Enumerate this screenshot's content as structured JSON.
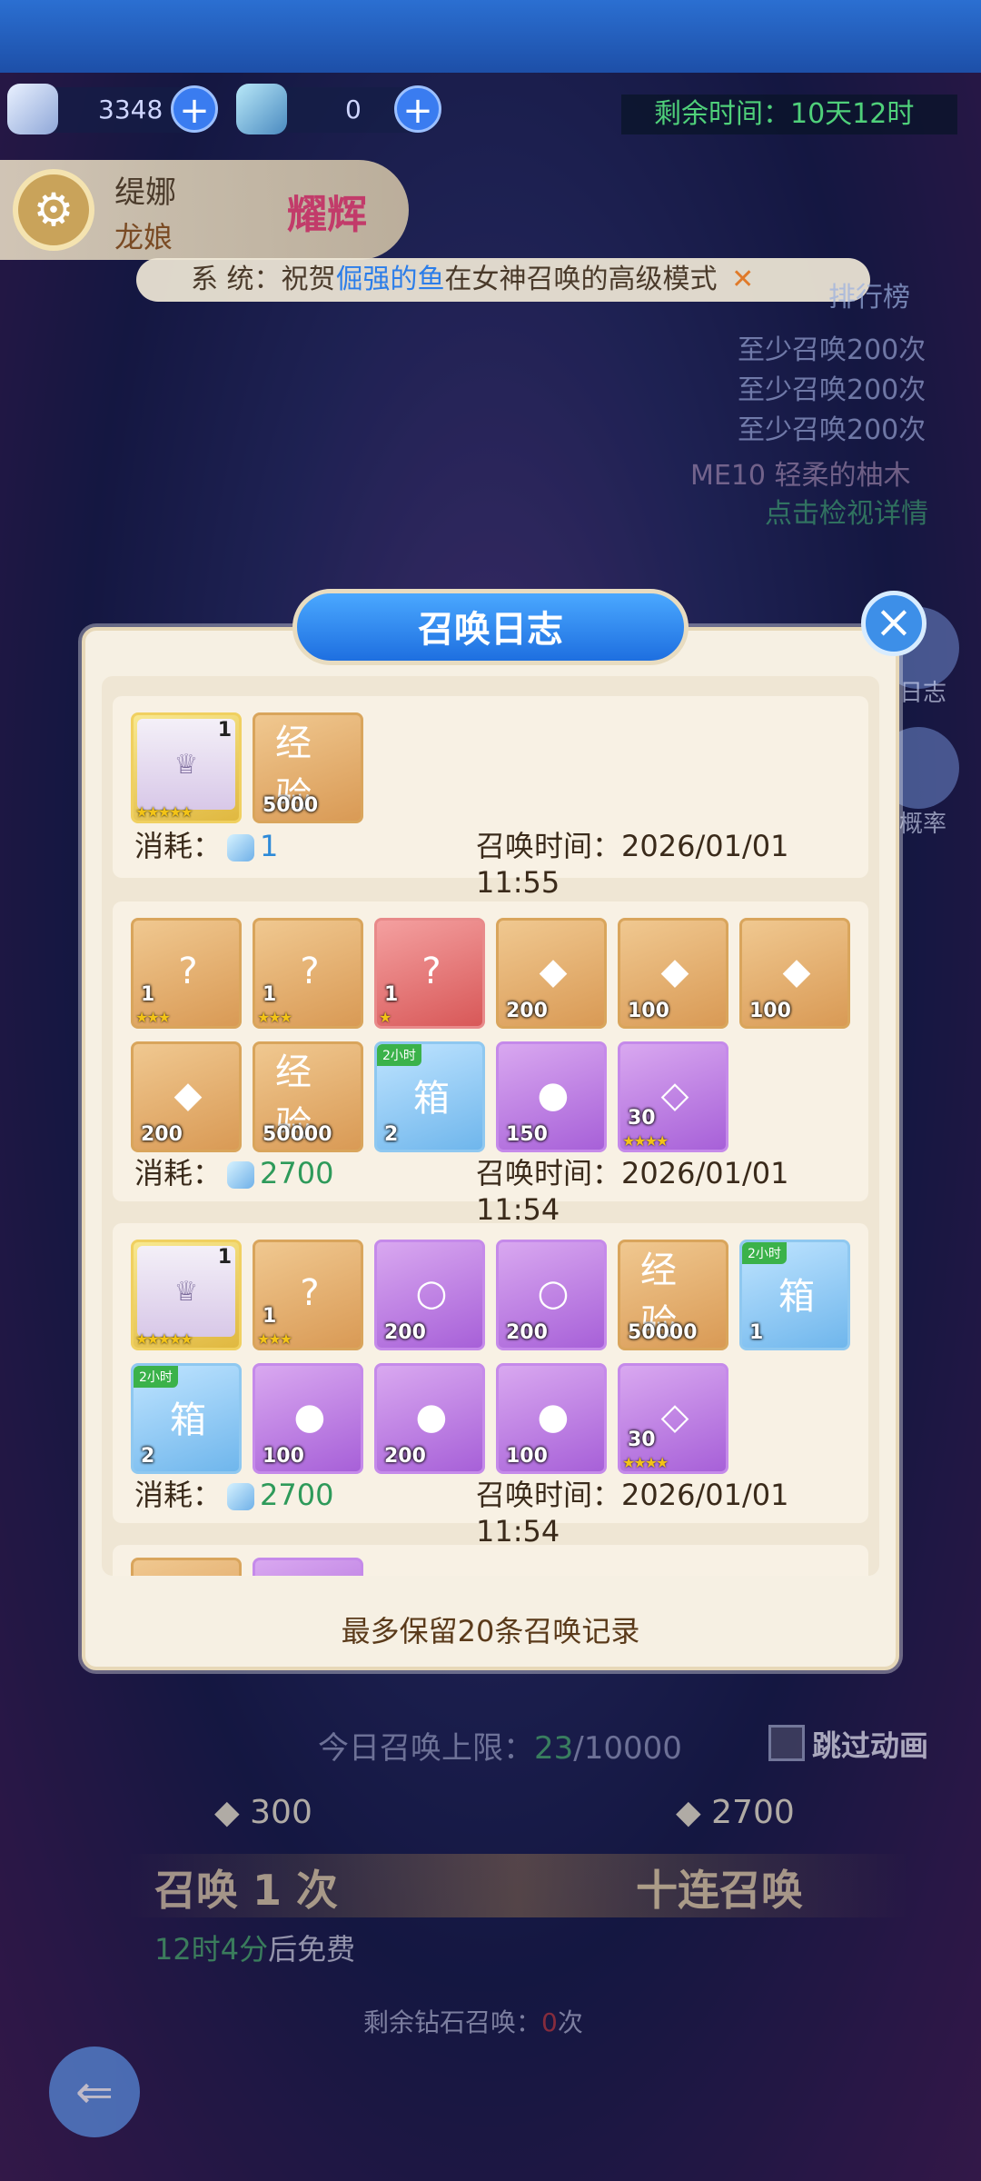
{
  "currency": [
    {
      "value": "3348",
      "icon": "diamond-icon"
    },
    {
      "value": "0",
      "icon": "crystal-egg-icon"
    }
  ],
  "timer": "剩余时间：10天12时",
  "hero": {
    "name": "缇娜",
    "subtitle": "龙娘",
    "tag": "耀辉"
  },
  "system_message": {
    "prefix": "系  统：祝贺",
    "name": "倔强的鱼",
    "suffix": "在女神召唤的高级模式"
  },
  "ranking": {
    "title": "排行榜",
    "rows": [
      "至少召唤200次",
      "至少召唤200次",
      "至少召唤200次"
    ],
    "me": "ME10  轻柔的柚木",
    "link": "点击检视详情"
  },
  "side": {
    "log_label": "日志",
    "rate_label": "概率"
  },
  "dialog": {
    "title": "召唤日志",
    "footer": "最多保留20条召唤记录",
    "cost_label": "消耗：",
    "time_label": "召唤时间：",
    "records": [
      {
        "cost": "1",
        "time": "2026/01/01 11:55",
        "items": [
          {
            "type": "portrait",
            "level": "1",
            "stars": 5
          },
          {
            "type": "orange",
            "qty": "5000",
            "label": "经验"
          }
        ]
      },
      {
        "cost": "2700",
        "time": "2026/01/01 11:54",
        "items": [
          {
            "type": "orange",
            "qty": "1",
            "label": "?",
            "stars": 3
          },
          {
            "type": "orange",
            "qty": "1",
            "label": "?",
            "stars": 3
          },
          {
            "type": "red",
            "qty": "1",
            "label": "?",
            "stars": 1
          },
          {
            "type": "orange",
            "qty": "200",
            "label": "◆"
          },
          {
            "type": "orange",
            "qty": "100",
            "label": "◆"
          },
          {
            "type": "orange",
            "qty": "100",
            "label": "◆"
          },
          {
            "type": "orange",
            "qty": "200",
            "label": "◆"
          },
          {
            "type": "orange",
            "qty": "50000",
            "label": "经验"
          },
          {
            "type": "blue",
            "qty": "2",
            "label": "箱",
            "tag": "2小时"
          },
          {
            "type": "purple",
            "qty": "150",
            "label": "●"
          },
          {
            "type": "purple",
            "qty": "30",
            "label": "◇",
            "stars": 4
          }
        ]
      },
      {
        "cost": "2700",
        "time": "2026/01/01 11:54",
        "items": [
          {
            "type": "portrait",
            "level": "1",
            "stars": 5
          },
          {
            "type": "orange",
            "qty": "1",
            "label": "?",
            "stars": 3
          },
          {
            "type": "purple",
            "qty": "200",
            "label": "○"
          },
          {
            "type": "purple",
            "qty": "200",
            "label": "○"
          },
          {
            "type": "orange",
            "qty": "50000",
            "label": "经验"
          },
          {
            "type": "blue",
            "qty": "1",
            "label": "箱",
            "tag": "2小时"
          },
          {
            "type": "blue",
            "qty": "2",
            "label": "箱",
            "tag": "2小时"
          },
          {
            "type": "purple",
            "qty": "100",
            "label": "●"
          },
          {
            "type": "purple",
            "qty": "200",
            "label": "●"
          },
          {
            "type": "purple",
            "qty": "100",
            "label": "●"
          },
          {
            "type": "purple",
            "qty": "30",
            "label": "◇",
            "stars": 4
          }
        ]
      }
    ]
  },
  "bottom": {
    "limit_prefix": "今日召唤上限：",
    "limit_count": "23",
    "limit_total": "/10000",
    "skip_label": "跳过动画",
    "single_cost": "300",
    "ten_cost": "2700",
    "single_label": "召唤 1 次",
    "ten_label": "十连召唤",
    "free_time": "12时4分",
    "free_suffix": "后免费",
    "remain_prefix": "剩余钻石召唤：",
    "remain_count": "0",
    "remain_suffix": "次"
  }
}
